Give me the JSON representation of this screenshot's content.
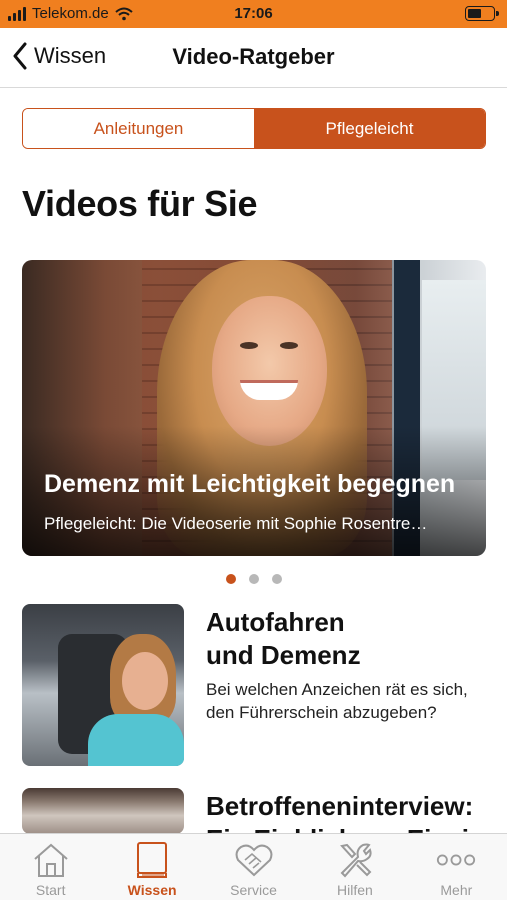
{
  "status_bar": {
    "carrier": "Telekom.de",
    "time": "17:06"
  },
  "nav": {
    "back_label": "Wissen",
    "title": "Video-Ratgeber"
  },
  "segments": [
    {
      "label": "Anleitungen",
      "active": false
    },
    {
      "label": "Pflegeleicht",
      "active": true
    }
  ],
  "section_heading": "Videos für Sie",
  "hero": {
    "title": "Demenz mit Leichtigkeit begegnen",
    "subtitle": "Pflegeleicht: Die Videoserie mit Sophie Rosentre…"
  },
  "carousel": {
    "page_count": 3,
    "active_index": 0
  },
  "videos": [
    {
      "title_line1": "Autofahren",
      "title_line2": "und Demenz",
      "desc_line1": "Bei welchen Anzeichen rät es sich,",
      "desc_line2": "den Führerschein abzugeben?"
    },
    {
      "title_line1": "Betroffeneninterview:",
      "title_line2": "Ein Einblick zur Einsic"
    }
  ],
  "tabs": [
    {
      "label": "Start",
      "icon": "house-icon",
      "active": false
    },
    {
      "label": "Wissen",
      "icon": "book-icon",
      "active": true
    },
    {
      "label": "Service",
      "icon": "handshake-icon",
      "active": false
    },
    {
      "label": "Hilfen",
      "icon": "tools-icon",
      "active": false
    },
    {
      "label": "Mehr",
      "icon": "more-dots-icon",
      "active": false
    }
  ],
  "colors": {
    "accent": "#c8521c",
    "status_bar": "#f07f1f",
    "inactive_tab": "#9a9a9a"
  }
}
